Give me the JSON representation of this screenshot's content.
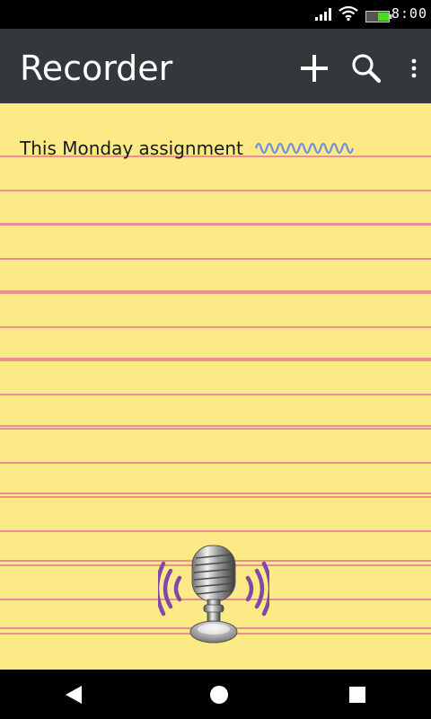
{
  "status_bar": {
    "time": "8:00",
    "icons": [
      "signal-icon",
      "wifi-icon",
      "battery-icon"
    ]
  },
  "app_bar": {
    "title": "Recorder",
    "actions": [
      "add-icon",
      "search-icon",
      "more-vert-icon"
    ]
  },
  "notes": [
    {
      "title": "This Monday assignment",
      "indicator": "waveform-icon"
    }
  ],
  "fab": {
    "icon": "microphone-icon"
  },
  "nav_bar": {
    "buttons": [
      "back-icon",
      "home-icon",
      "recents-icon"
    ]
  },
  "colors": {
    "status_bar_bg": "#000000",
    "app_bar_bg": "#33383b",
    "paper_bg": "#fbea86",
    "rule_line": "#e88f8f",
    "waveform": "#6f8fe0",
    "mic_waves": "#7d4aa6",
    "battery_fill": "#44dd22"
  }
}
